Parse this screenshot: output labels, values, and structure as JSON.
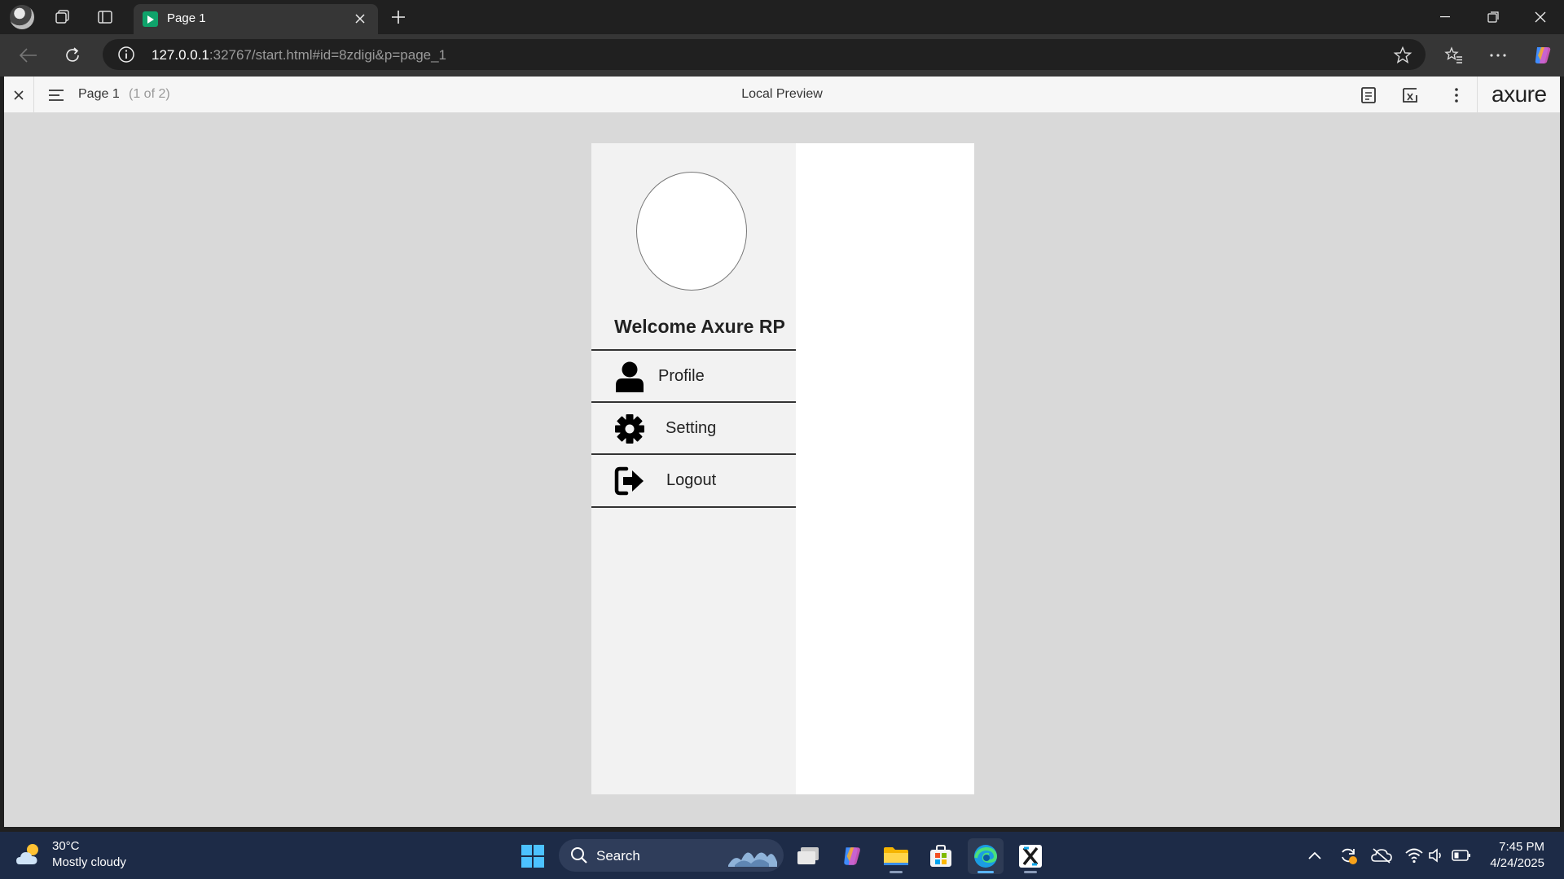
{
  "browser": {
    "tab_title": "Page 1",
    "url_host": "127.0.0.1",
    "url_rest": ":32767/start.html#id=8zdigi&p=page_1"
  },
  "axure": {
    "page_name": "Page 1",
    "page_count": "(1 of 2)",
    "center_title": "Local Preview",
    "logo": "axure"
  },
  "prototype": {
    "welcome": "Welcome Axure RP",
    "menu": [
      {
        "label": "Profile",
        "icon": "user-icon"
      },
      {
        "label": "Setting",
        "icon": "gear-icon"
      },
      {
        "label": "Logout",
        "icon": "logout-icon"
      }
    ]
  },
  "taskbar": {
    "weather_temp": "30°C",
    "weather_desc": "Mostly cloudy",
    "search_placeholder": "Search",
    "time": "7:45 PM",
    "date": "4/24/2025"
  },
  "colors": {
    "viewer_bg": "#d9d9d9",
    "menu_bg": "#f2f2f2",
    "taskbar_bg": "#1d2b47"
  }
}
